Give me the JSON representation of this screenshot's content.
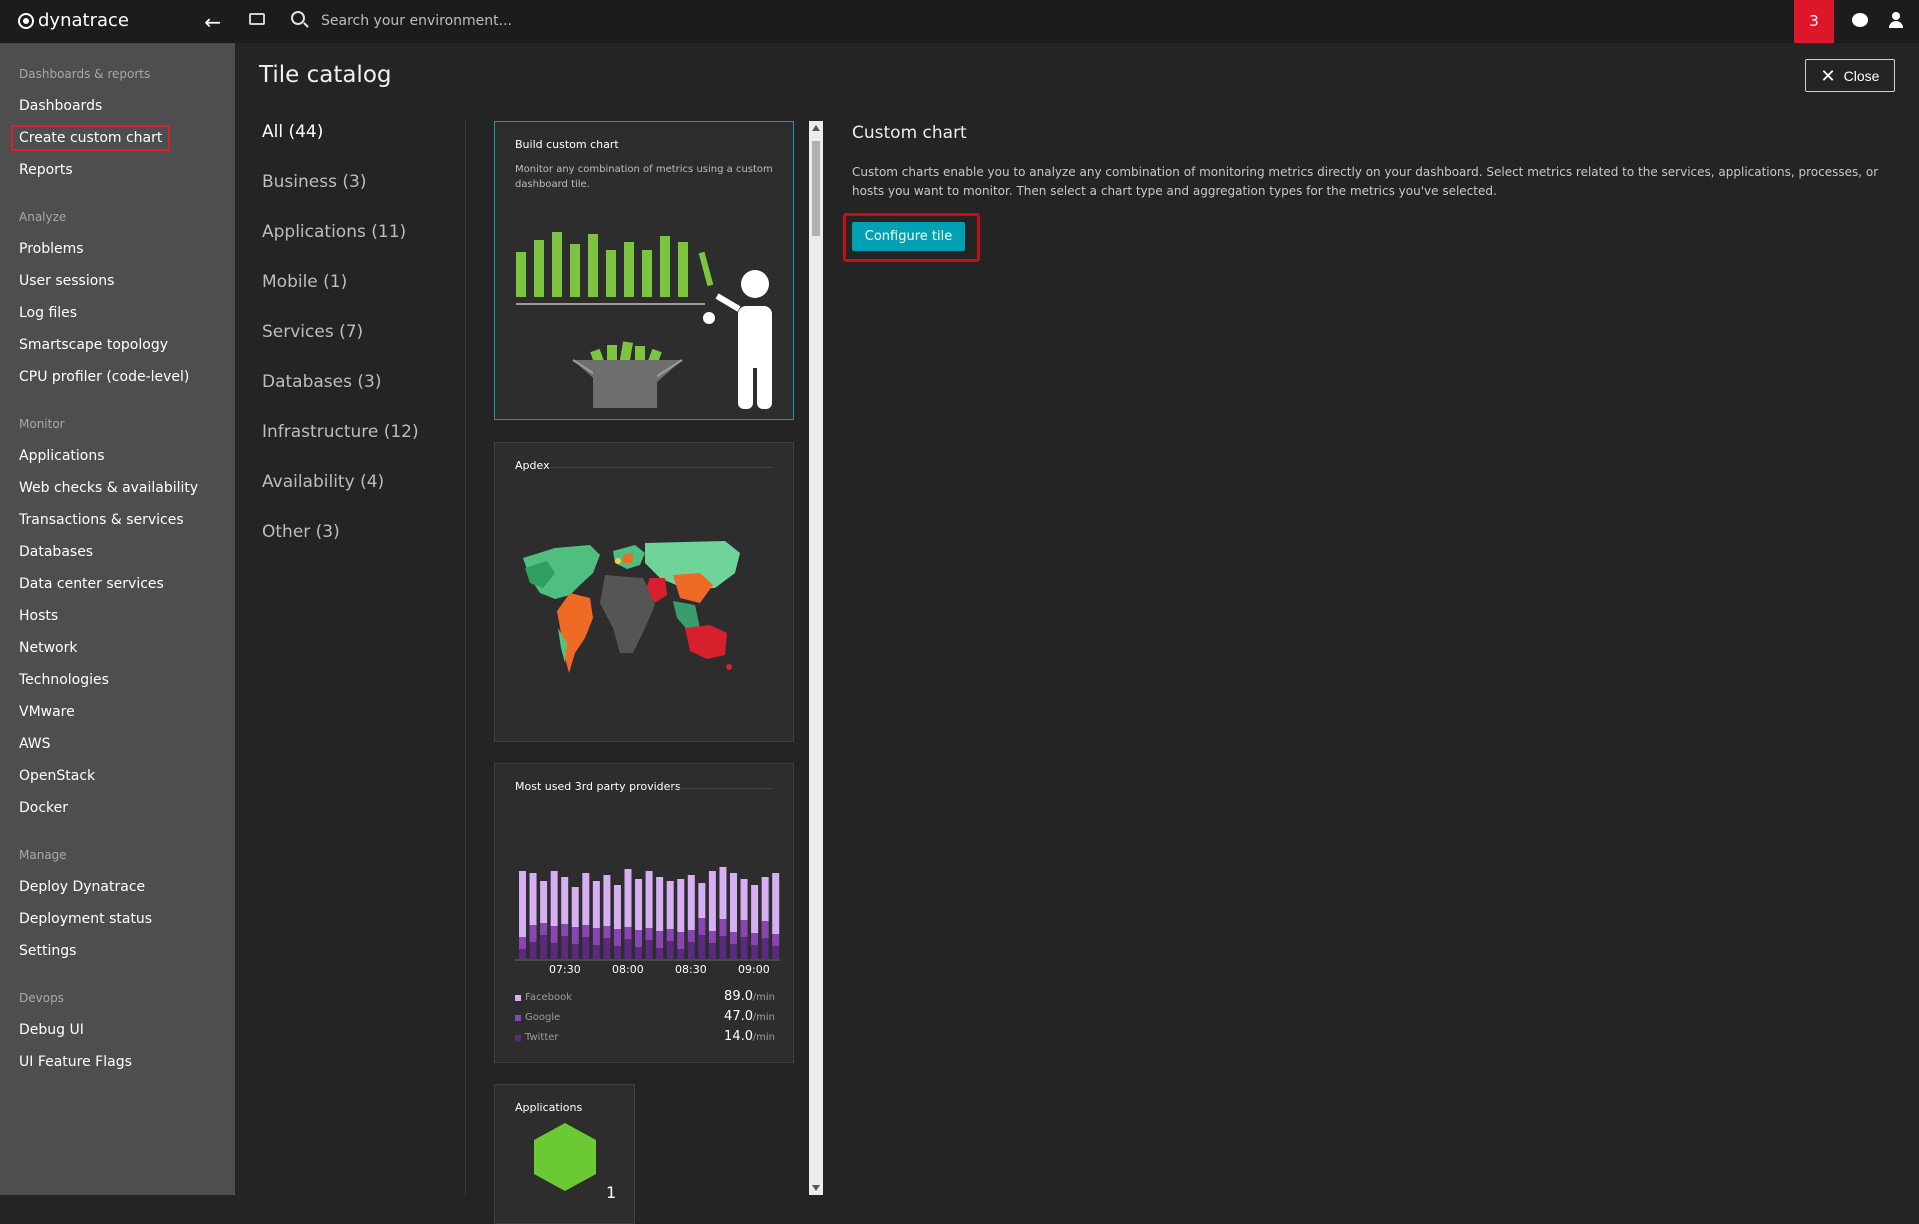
{
  "app": {
    "logo_text": "dynatrace"
  },
  "topbar": {
    "search_placeholder": "Search your environment...",
    "notifications_count": "3"
  },
  "sidebar": {
    "sections": [
      {
        "heading": "Dashboards & reports",
        "items": [
          "Dashboards",
          "Create custom chart",
          "Reports"
        ]
      },
      {
        "heading": "Analyze",
        "items": [
          "Problems",
          "User sessions",
          "Log files",
          "Smartscape topology",
          "CPU profiler (code-level)"
        ]
      },
      {
        "heading": "Monitor",
        "items": [
          "Applications",
          "Web checks & availability",
          "Transactions & services",
          "Databases",
          "Data center services",
          "Hosts",
          "Network",
          "Technologies",
          "VMware",
          "AWS",
          "OpenStack",
          "Docker"
        ]
      },
      {
        "heading": "Manage",
        "items": [
          "Deploy Dynatrace",
          "Deployment status",
          "Settings"
        ]
      },
      {
        "heading": "Devops",
        "items": [
          "Debug UI",
          "UI Feature Flags"
        ]
      }
    ],
    "highlighted_item": "Create custom chart"
  },
  "page": {
    "title": "Tile catalog",
    "close_label": "Close"
  },
  "categories": [
    "All (44)",
    "Business (3)",
    "Applications (11)",
    "Mobile (1)",
    "Services (7)",
    "Databases (3)",
    "Infrastructure (12)",
    "Availability (4)",
    "Other (3)"
  ],
  "tiles": {
    "custom_chart": {
      "title": "Build custom chart",
      "description": "Monitor any combination of metrics using a custom dashboard tile."
    },
    "apdex": {
      "title": "Apdex"
    },
    "third_party": {
      "title": "Most used 3rd party providers",
      "x_labels": [
        "07:30",
        "08:00",
        "08:30",
        "09:00"
      ],
      "legend": [
        {
          "name": "Facebook",
          "value": "89.0",
          "unit": "/min",
          "color": "#d6b0f2"
        },
        {
          "name": "Google",
          "value": "47.0",
          "unit": "/min",
          "color": "#8a45b5"
        },
        {
          "name": "Twitter",
          "value": "14.0",
          "unit": "/min",
          "color": "#5a2a7e"
        }
      ]
    },
    "applications": {
      "title": "Applications",
      "count": "1"
    }
  },
  "detail": {
    "title": "Custom chart",
    "description": "Custom charts enable you to analyze any combination of monitoring metrics directly on your dashboard. Select metrics related to the services, applications, processes, or hosts you want to monitor. Then select a chart type and aggregation types for the metrics you've selected.",
    "configure_label": "Configure tile"
  },
  "colors": {
    "accent": "#00a1b2",
    "highlight_red": "#c10e19",
    "chart_green": "#7dc540"
  }
}
